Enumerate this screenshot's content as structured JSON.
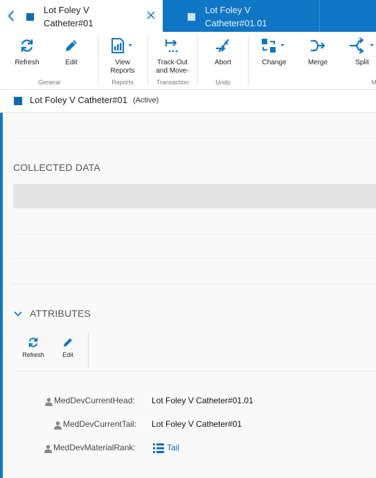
{
  "tabs": {
    "active": {
      "title": "Lot Foley V Catheter#01"
    },
    "inactive": {
      "title": "Lot Foley V Catheter#01.01"
    }
  },
  "toolbar": {
    "buttons": [
      {
        "label": "Refresh",
        "icon": "refresh-icon"
      },
      {
        "label": "Edit",
        "icon": "pencil-icon"
      },
      {
        "label": "View Reports",
        "icon": "report-icon"
      },
      {
        "label": "Track-Out and Move-",
        "icon": "track-out-icon"
      },
      {
        "label": "Abort",
        "icon": "abort-icon"
      },
      {
        "label": "Change",
        "icon": "change-icon"
      },
      {
        "label": "Merge",
        "icon": "merge-icon"
      },
      {
        "label": "Split",
        "icon": "split-icon"
      }
    ],
    "groups": {
      "general": "General",
      "reports": "Reports",
      "transaction": "Transaction",
      "undo": "Undo",
      "truncated": "M"
    }
  },
  "object": {
    "title": "Lot Foley V Catheter#01",
    "status": "(Active)"
  },
  "sections": {
    "collected_data": "COLLECTED DATA",
    "attributes": "ATTRIBUTES"
  },
  "attributes_toolbar": {
    "refresh": "Refresh",
    "edit": "Edit"
  },
  "attributes": [
    {
      "key": "MedDevCurrentHead:",
      "value": "Lot Foley V Catheter#01.01"
    },
    {
      "key": "MedDevCurrentTail:",
      "value": "Lot Foley V Catheter#01"
    },
    {
      "key": "MedDevMaterialRank:",
      "value": "Tail"
    }
  ],
  "colors": {
    "accent": "#0f76c6",
    "link": "#0f6ab4"
  }
}
